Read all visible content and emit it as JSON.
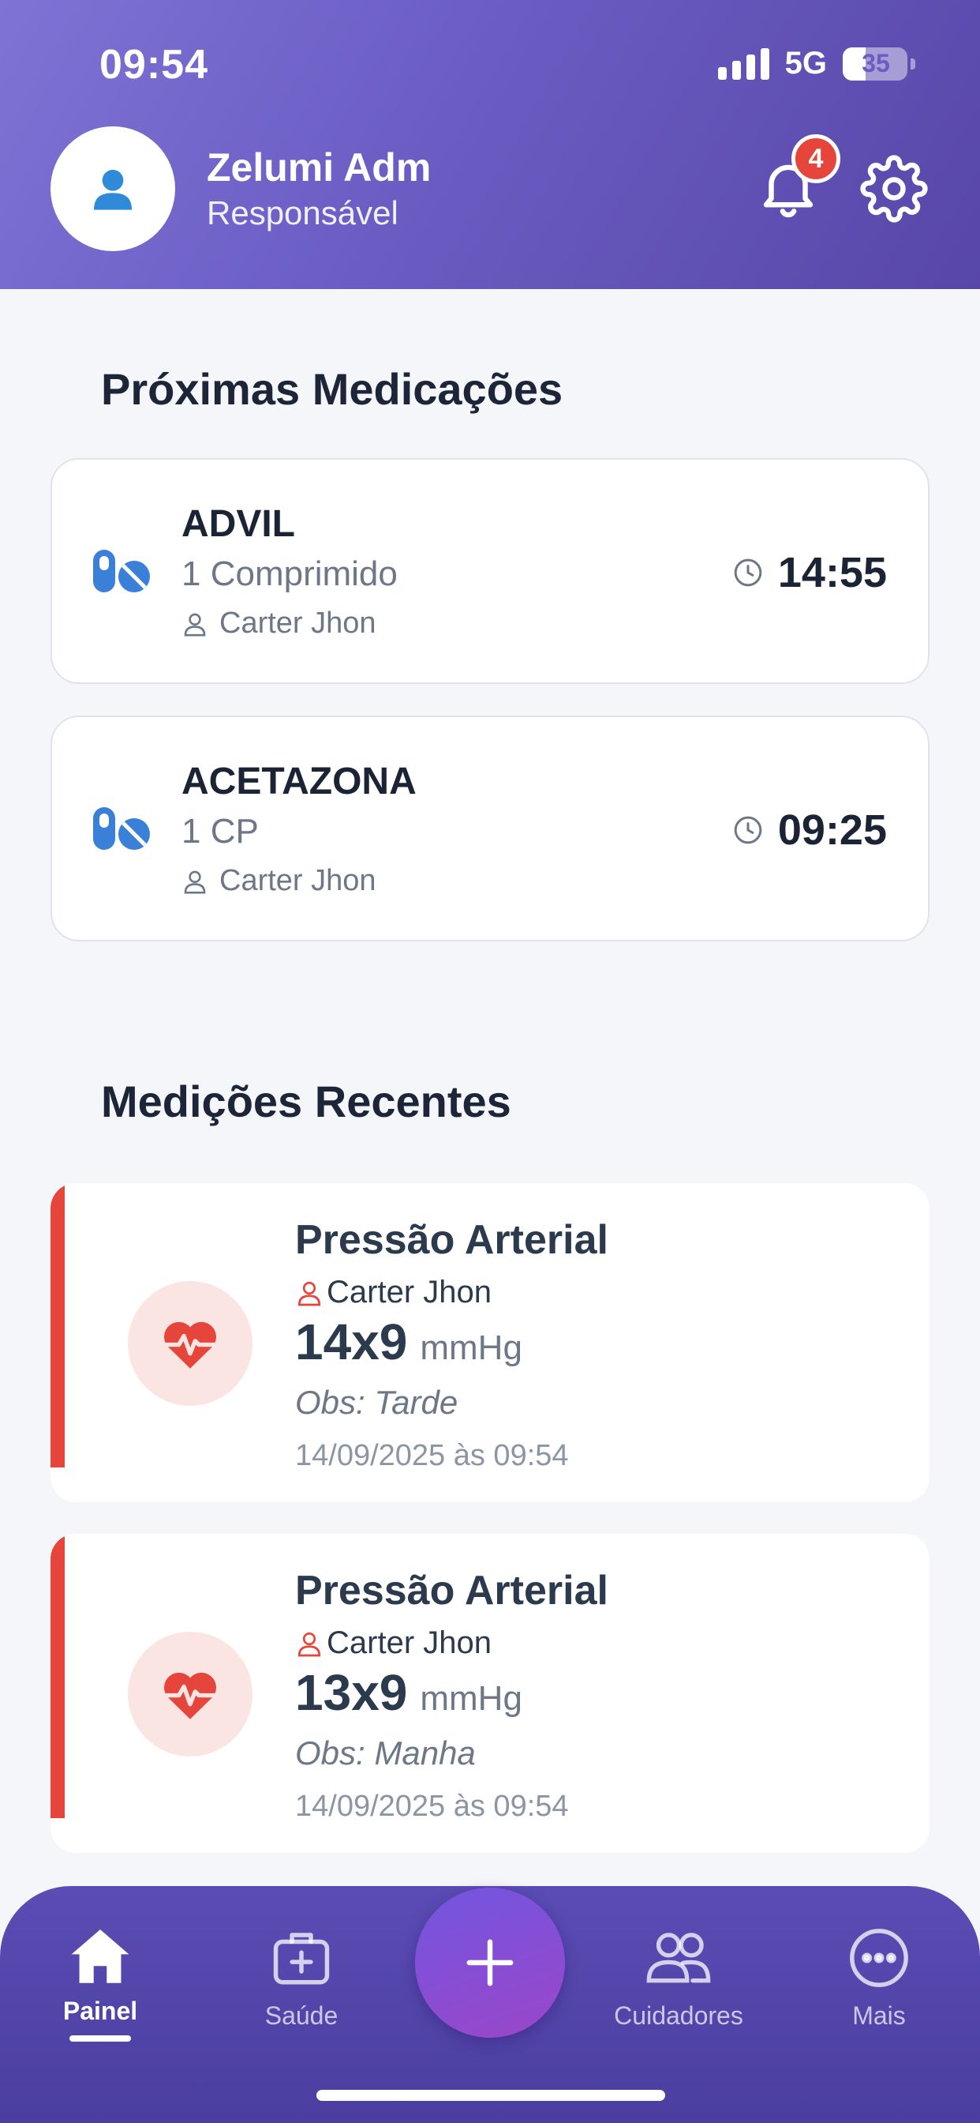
{
  "status_bar": {
    "time": "09:54",
    "network": "5G",
    "battery": "35",
    "battery_level": 0.35
  },
  "header": {
    "user_name": "Zelumi Adm",
    "user_role": "Responsável",
    "notification_count": "4",
    "icons": [
      "user-icon",
      "bell-icon",
      "gear-icon"
    ]
  },
  "medications": {
    "title": "Próximas Medicações",
    "items": [
      {
        "name": "ADVIL",
        "dose": "1 Comprimido",
        "patient": "Carter Jhon",
        "time": "14:55"
      },
      {
        "name": "ACETAZONA",
        "dose": "1 CP",
        "patient": "Carter Jhon",
        "time": "09:25"
      }
    ]
  },
  "measurements": {
    "title": "Medições Recentes",
    "items": [
      {
        "title": "Pressão Arterial",
        "patient": "Carter Jhon",
        "value": "14x9",
        "unit": "mmHg",
        "obs": "Obs: Tarde",
        "date": "14/09/2025 às 09:54"
      },
      {
        "title": "Pressão Arterial",
        "patient": "Carter Jhon",
        "value": "13x9",
        "unit": "mmHg",
        "obs": "Obs: Manha",
        "date": "14/09/2025 às 09:54"
      }
    ]
  },
  "bottom_nav": {
    "items": [
      {
        "label": "Painel",
        "icon": "home-icon",
        "active": true
      },
      {
        "label": "Saúde",
        "icon": "medical-kit-icon",
        "active": false
      },
      {
        "label": "Cuidadores",
        "icon": "users-icon",
        "active": false
      },
      {
        "label": "Mais",
        "icon": "more-icon",
        "active": false
      }
    ],
    "fab_icon": "plus-icon"
  },
  "colors": {
    "header_gradient_start": "#7f73d6",
    "header_gradient_end": "#5847a8",
    "accent_blue": "#3a7fd8",
    "alert_red": "#e5453b",
    "nav_background": "#4b3ea0",
    "fab_gradient_start": "#7256e0",
    "fab_gradient_end": "#9b46c9"
  }
}
